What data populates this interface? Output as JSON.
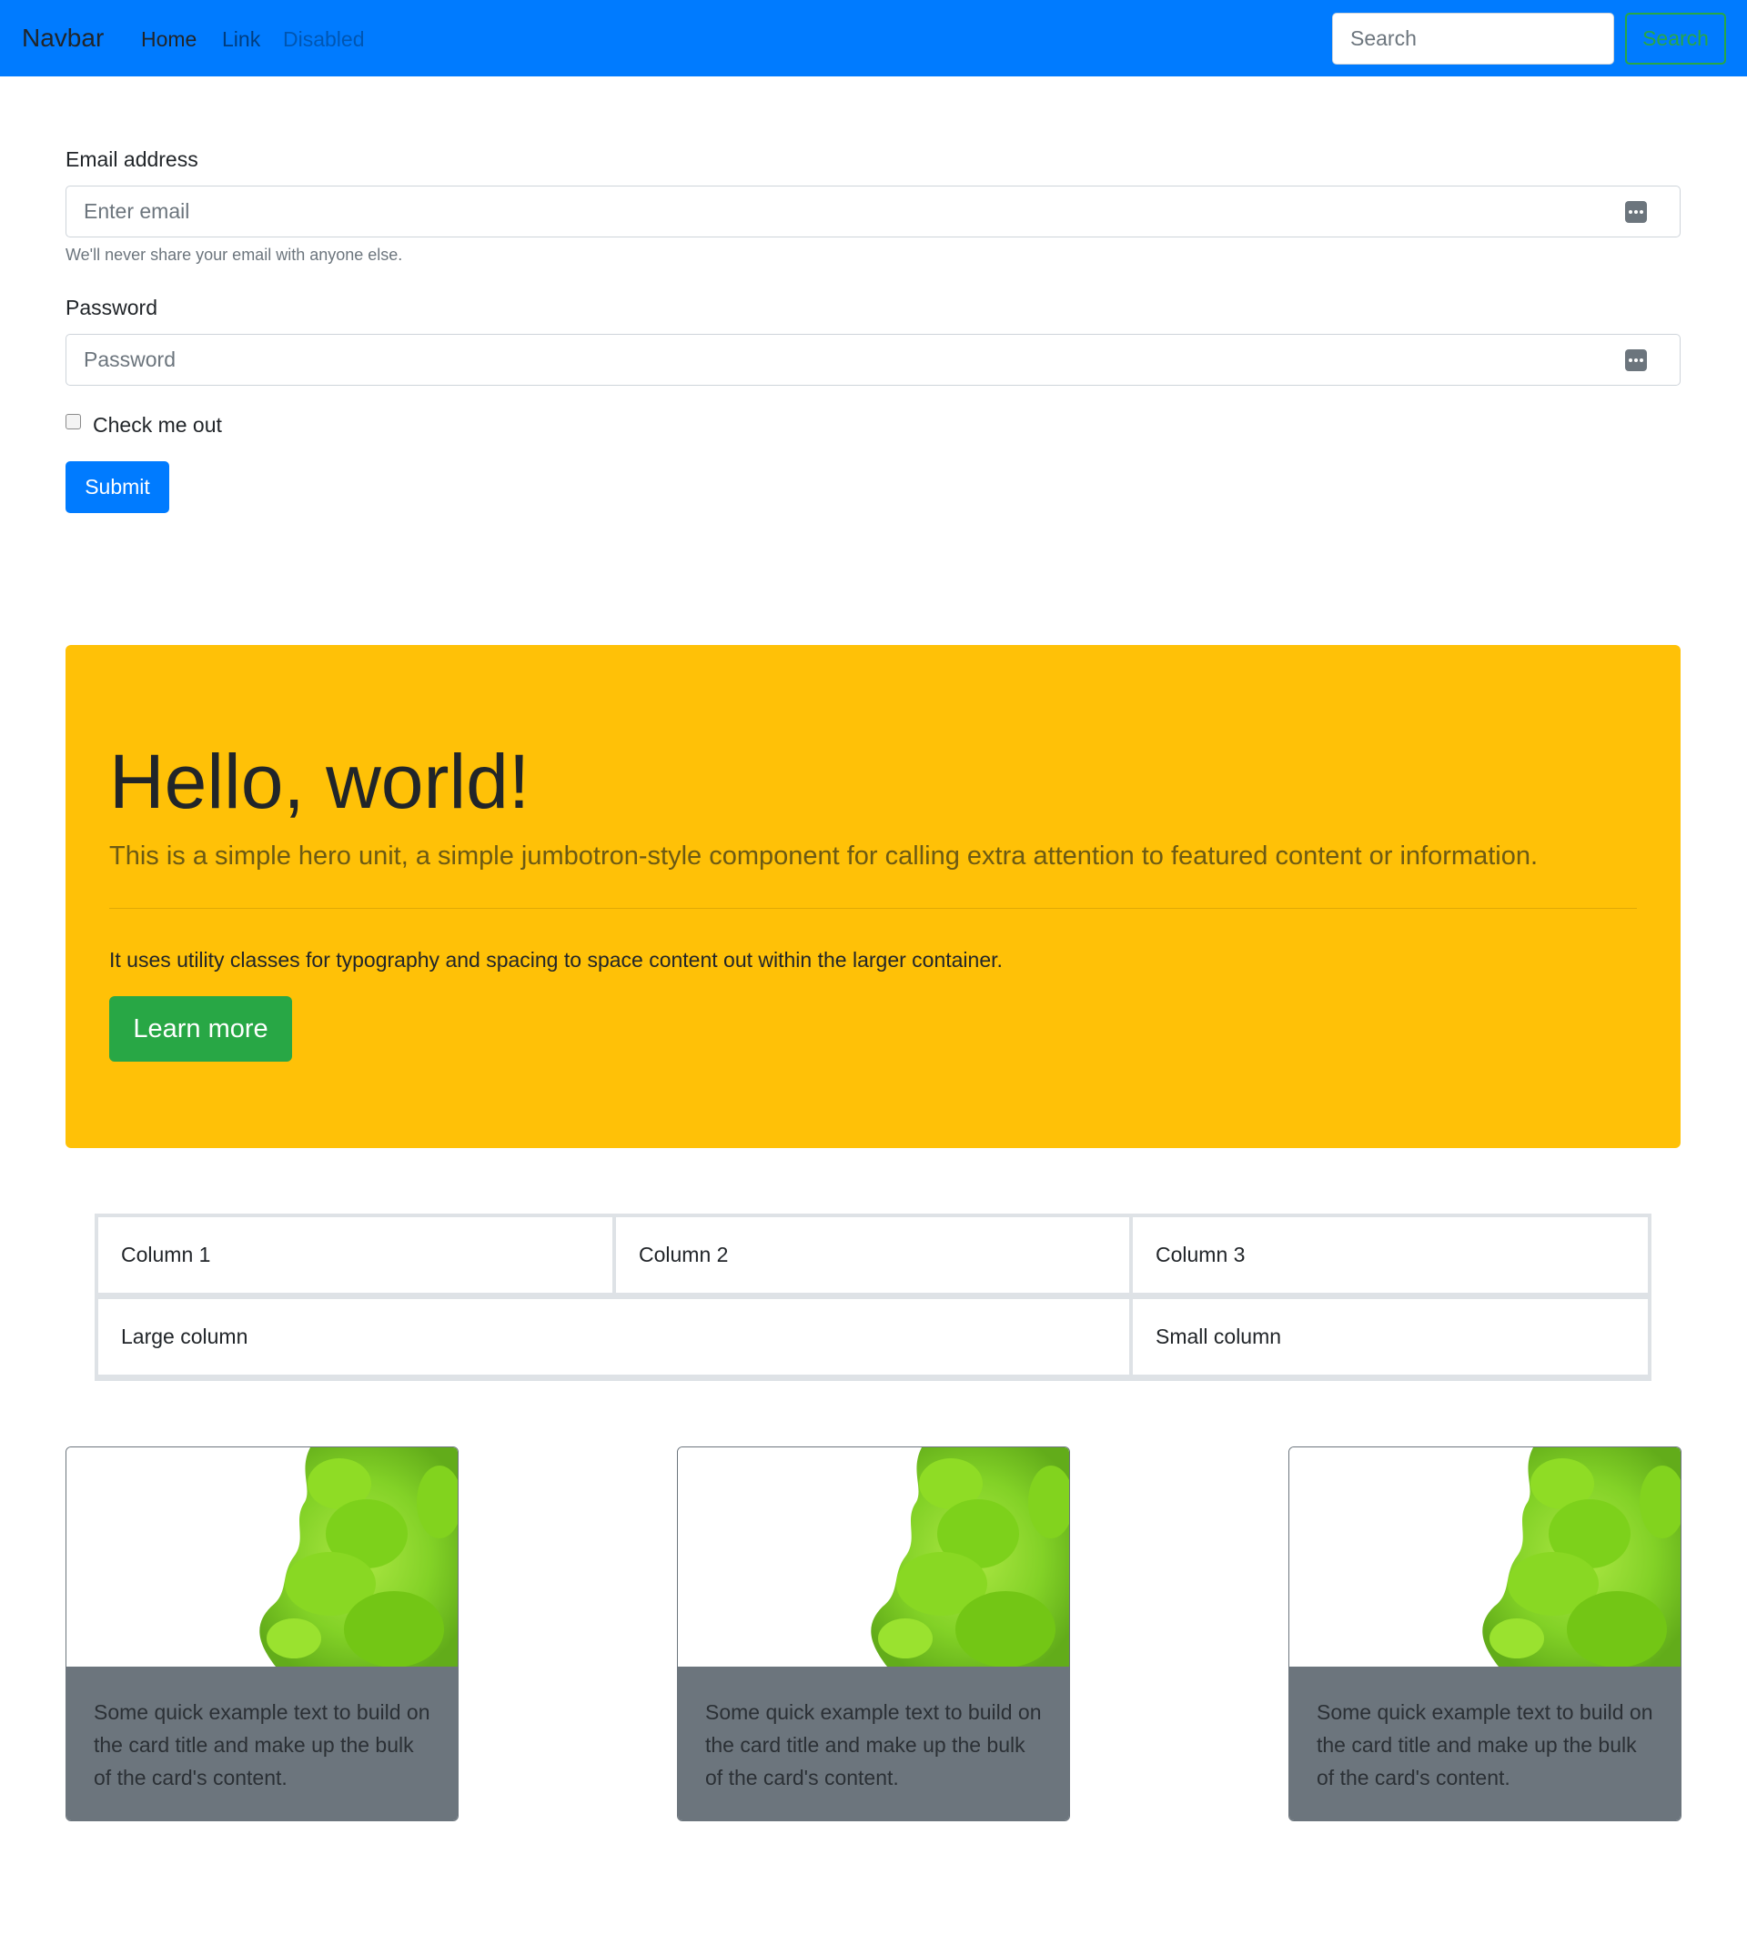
{
  "navbar": {
    "brand": "Navbar",
    "links": [
      "Home",
      "Link",
      "Disabled"
    ],
    "search_placeholder": "Search",
    "search_button": "Search",
    "background": "#007bff"
  },
  "form": {
    "email_label": "Email address",
    "email_placeholder": "Enter email",
    "email_help": "We'll never share your email with anyone else.",
    "password_label": "Password",
    "password_placeholder": "Password",
    "checkbox_label": "Check me out",
    "submit_label": "Submit"
  },
  "jumbotron": {
    "heading": "Hello, world!",
    "lead": "This is a simple hero unit, a simple jumbotron-style component for calling extra attention to featured content or information.",
    "text": "It uses utility classes for typography and spacing to space content out within the larger container.",
    "button": "Learn more",
    "background": "#ffc107"
  },
  "grid": {
    "row1": [
      "Column 1",
      "Column 2",
      "Column 3"
    ],
    "row2": [
      "Large column",
      "Small column"
    ]
  },
  "cards": [
    {
      "text": "Some quick example text to build on the card title and make up the bulk of the card's content.",
      "image_icon": "green-ink-image"
    },
    {
      "text": "Some quick example text to build on the card title and make up the bulk of the card's content.",
      "image_icon": "green-ink-image"
    },
    {
      "text": "Some quick example text to build on the card title and make up the bulk of the card's content.",
      "image_icon": "green-ink-image"
    }
  ]
}
